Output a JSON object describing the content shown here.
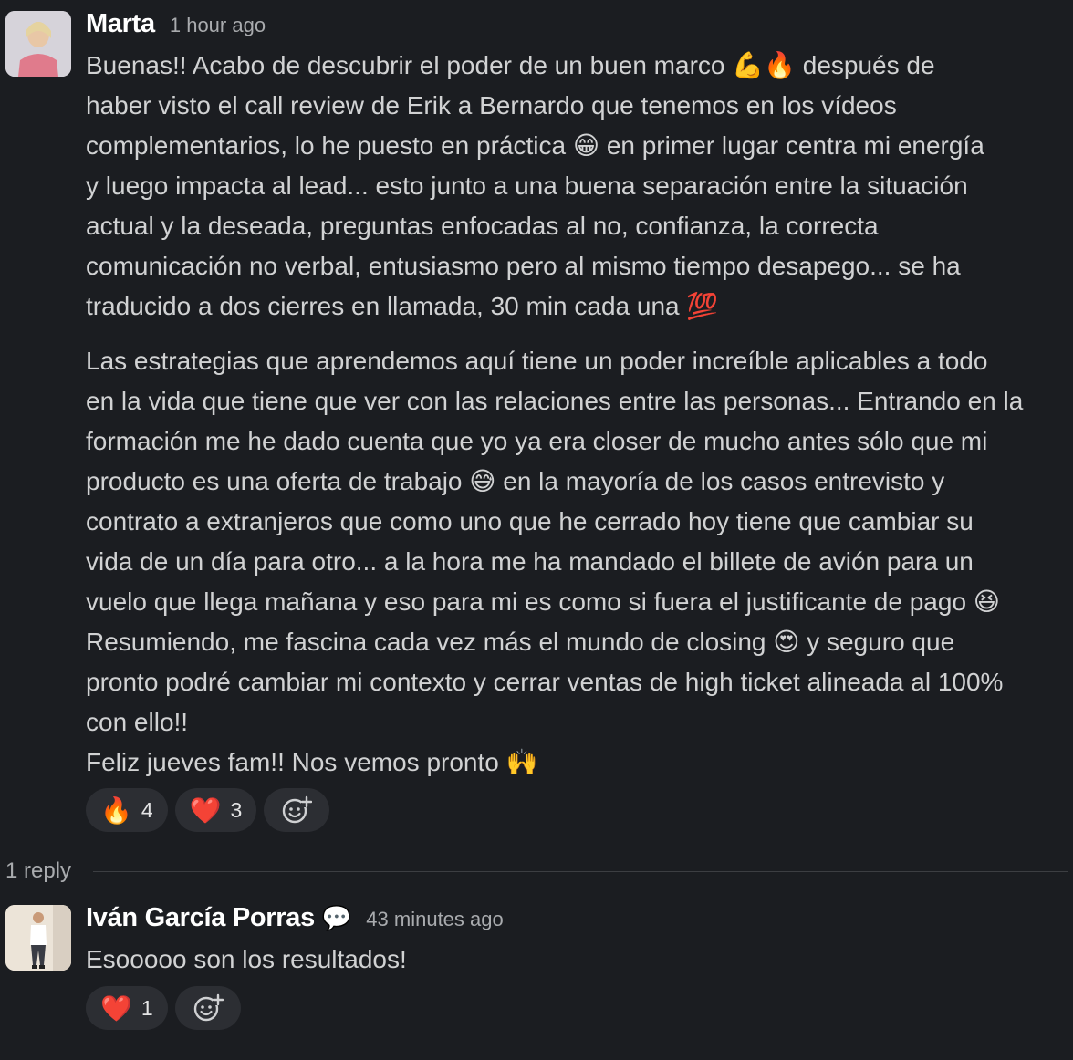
{
  "thread": {
    "message": {
      "author": "Marta",
      "timestamp": "1 hour ago",
      "lines_p1": [
        "Buenas!! Acabo de descubrir el poder de un buen marco 💪🔥 después de",
        "haber visto el call review de Erik a Bernardo que tenemos en los vídeos",
        "complementarios, lo he puesto en práctica 😁 en primer lugar centra mi energía",
        "y luego impacta al lead... esto junto a una buena separación entre la situación",
        "actual y la deseada, preguntas enfocadas al no, confianza, la correcta",
        "comunicación no verbal, entusiasmo pero al mismo tiempo desapego... se ha",
        "traducido a dos cierres en llamada, 30 min cada una 💯"
      ],
      "lines_p2": [
        "Las estrategias que aprendemos aquí tiene un poder increíble aplicables a todo",
        "en la vida que tiene que ver con las relaciones entre las personas... Entrando en la",
        "formación me he dado cuenta que yo ya era closer de mucho antes sólo que mi",
        "producto es una oferta de trabajo 😅  en la mayoría de los casos entrevisto y",
        "contrato a extranjeros que como uno que he cerrado hoy tiene que cambiar su",
        "vida de un día para otro... a la hora me ha mandado el billete de avión para un",
        "vuelo que llega mañana y eso para mi es como si fuera el justificante de pago 😆",
        "Resumiendo,  me fascina cada vez más el mundo de closing 😍 y seguro que",
        "pronto podré cambiar mi contexto y cerrar ventas de high ticket alineada al 100%",
        "con ello!!",
        "Feliz jueves fam!! Nos vemos pronto 🙌"
      ],
      "reactions": [
        {
          "emoji": "🔥",
          "count": "4"
        },
        {
          "emoji": "❤️",
          "count": "3"
        }
      ],
      "add_reaction_icon": "add-emoji-icon"
    },
    "replies_label": "1 reply",
    "reply": {
      "author": "Iván García Porras",
      "status_emoji": "💬",
      "timestamp": "43 minutes ago",
      "text": "Esooooo son los resultados!",
      "reactions": [
        {
          "emoji": "❤️",
          "count": "1"
        }
      ],
      "add_reaction_icon": "add-emoji-icon"
    }
  }
}
